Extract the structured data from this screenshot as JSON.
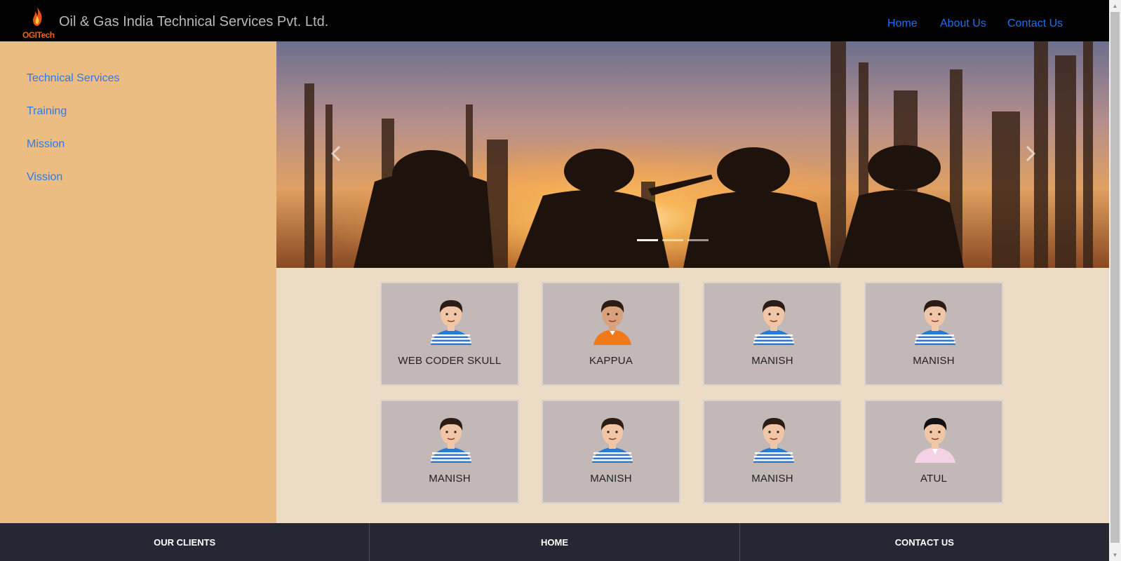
{
  "header": {
    "logo_text": "OGITech",
    "brand": "Oil & Gas India Technical Services Pvt. Ltd.",
    "nav": [
      "Home",
      "About Us",
      "Contact Us"
    ]
  },
  "sidebar": {
    "items": [
      "Technical Services",
      "Training",
      "Mission",
      "Vission"
    ]
  },
  "carousel": {
    "prev_icon": "chevron-left-icon",
    "next_icon": "chevron-right-icon",
    "active_slide": 1,
    "slide_count": 3
  },
  "team": [
    {
      "name": "WEB CODER SKULL",
      "avatar": "striped-shirt-man"
    },
    {
      "name": "KAPPUA",
      "avatar": "orange-shirt-man"
    },
    {
      "name": "MANISH",
      "avatar": "striped-shirt-man"
    },
    {
      "name": "MANISH",
      "avatar": "striped-shirt-man"
    },
    {
      "name": "MANISH",
      "avatar": "striped-shirt-man"
    },
    {
      "name": "MANISH",
      "avatar": "striped-shirt-man"
    },
    {
      "name": "MANISH",
      "avatar": "striped-shirt-man"
    },
    {
      "name": "ATUL",
      "avatar": "pink-shirt-man"
    }
  ],
  "footer": [
    "OUR CLIENTS",
    "HOME",
    "CONTACT US"
  ],
  "colors": {
    "header_bg": "#000000",
    "nav_link": "#1d6ff2",
    "sidebar_bg": "#ecbd83",
    "content_bg": "#ecdcc6",
    "card_bg": "#c3b8b8",
    "footer_bg": "#252832"
  }
}
